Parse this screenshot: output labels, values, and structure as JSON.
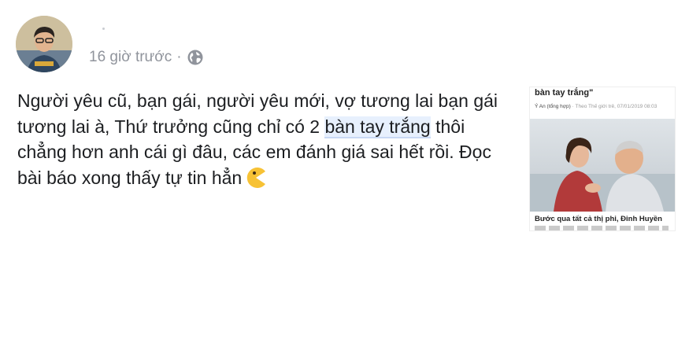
{
  "post": {
    "timestamp": "16 giờ trước",
    "separator": "·",
    "privacy_icon": "globe-icon",
    "text_before": "Người yêu cũ, bạn gái, người yêu mới, vợ tương lai bạn gái tương lai à, Thứ trưởng cũng chỉ có 2 ",
    "text_link": "bàn tay trắng",
    "text_after": " thôi chẳng hơn anh cái gì đâu, các em đánh giá sai hết rồi. Đọc bài báo xong thấy tự tin hẳn",
    "emoji": "pacman-emoji-icon"
  },
  "attachment": {
    "title": "bàn tay trắng\"",
    "author": "Ý An (tổng hợp)",
    "source": " · Theo Thế giới trẻ, 07/01/2019 08:03",
    "caption": "Bước qua tất cả thị phi, Đinh Huyền"
  },
  "colors": {
    "text": "#1c1e21",
    "meta": "#90949c",
    "highlight": "#e7f0fd",
    "emoji": "#f7c235"
  }
}
